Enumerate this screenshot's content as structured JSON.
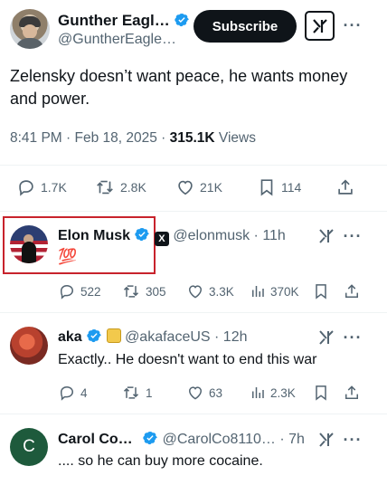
{
  "main_tweet": {
    "author_name": "Gunther Eagl…",
    "author_handle": "@GuntherEagle…",
    "subscribe_label": "Subscribe",
    "text": "Zelensky doesn’t want peace, he wants money and power.",
    "time": "8:41 PM · Feb 18, 2025 · ",
    "views_count": "315.1K",
    "views_label": " Views",
    "actions": {
      "replies": "1.7K",
      "reposts": "2.8K",
      "likes": "21K",
      "bookmarks": "114"
    }
  },
  "replies": [
    {
      "name": "Elon Musk",
      "handle": "@elonmusk",
      "time": "· 11h",
      "text": "💯",
      "actions": {
        "replies": "522",
        "reposts": "305",
        "likes": "3.3K",
        "views": "370K"
      }
    },
    {
      "name": "aka",
      "handle": "@akafaceUS",
      "time": "· 12h",
      "text": "Exactly.. He doesn't want to end this war",
      "actions": {
        "replies": "4",
        "reposts": "1",
        "likes": "63",
        "views": "2.3K"
      }
    },
    {
      "name": "Carol Co…",
      "handle": "@CarolCo8110…",
      "time": "· 7h",
      "avatar_letter": "C",
      "text": ".... so he can buy more cocaine."
    }
  ],
  "colors": {
    "verified_blue": "#1d9bf0",
    "text_gray": "#536471",
    "highlight_red": "#c8232c",
    "carol_avatar": "#1e5a3c"
  }
}
